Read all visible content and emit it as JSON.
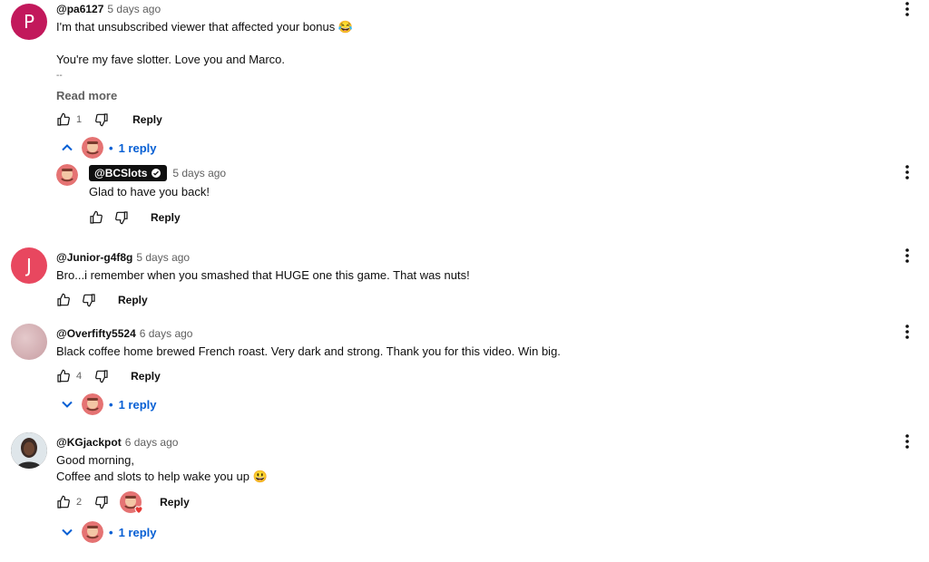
{
  "colors": {
    "link_blue": "#065fd4",
    "meta_gray": "#606060",
    "badge_bg": "#0f0f0f"
  },
  "comments": [
    {
      "author": "@pa6127",
      "time": "5 days ago",
      "avatar_letter": "P",
      "avatar_color": "#c2185b",
      "lines": [
        "I'm that unsubscribed viewer that affected your bonus 😂",
        "",
        "You're my fave slotter. Love you and Marco.",
        "--"
      ],
      "read_more": "Read more",
      "likes": "1",
      "reply_label": "Reply",
      "replies_toggle": "1 reply",
      "replies_expanded": true,
      "reply": {
        "author": "@BCSlots",
        "time": "5 days ago",
        "text": "Glad to have you back!",
        "reply_label": "Reply"
      }
    },
    {
      "author": "@Junior-g4f8g",
      "time": "5 days ago",
      "avatar_letter": "J",
      "avatar_color": "#e8475f",
      "lines": [
        "Bro...i remember when you smashed that HUGE one this game. That was nuts!"
      ],
      "likes": "",
      "reply_label": "Reply"
    },
    {
      "author": "@Overfifty5524",
      "time": "6 days ago",
      "avatar_color": "#d7b5b8",
      "lines": [
        "Black coffee home brewed French roast.  Very dark and strong.  Thank you for this video.  Win big."
      ],
      "likes": "4",
      "reply_label": "Reply",
      "replies_toggle": "1 reply",
      "replies_expanded": false
    },
    {
      "author": "@KGjackpot",
      "time": "6 days ago",
      "avatar_color": "#3b2a24",
      "lines": [
        "Good morning,",
        "Coffee and slots to help wake you up 😃"
      ],
      "likes": "2",
      "reply_label": "Reply",
      "replies_toggle": "1 reply",
      "replies_expanded": false
    }
  ]
}
